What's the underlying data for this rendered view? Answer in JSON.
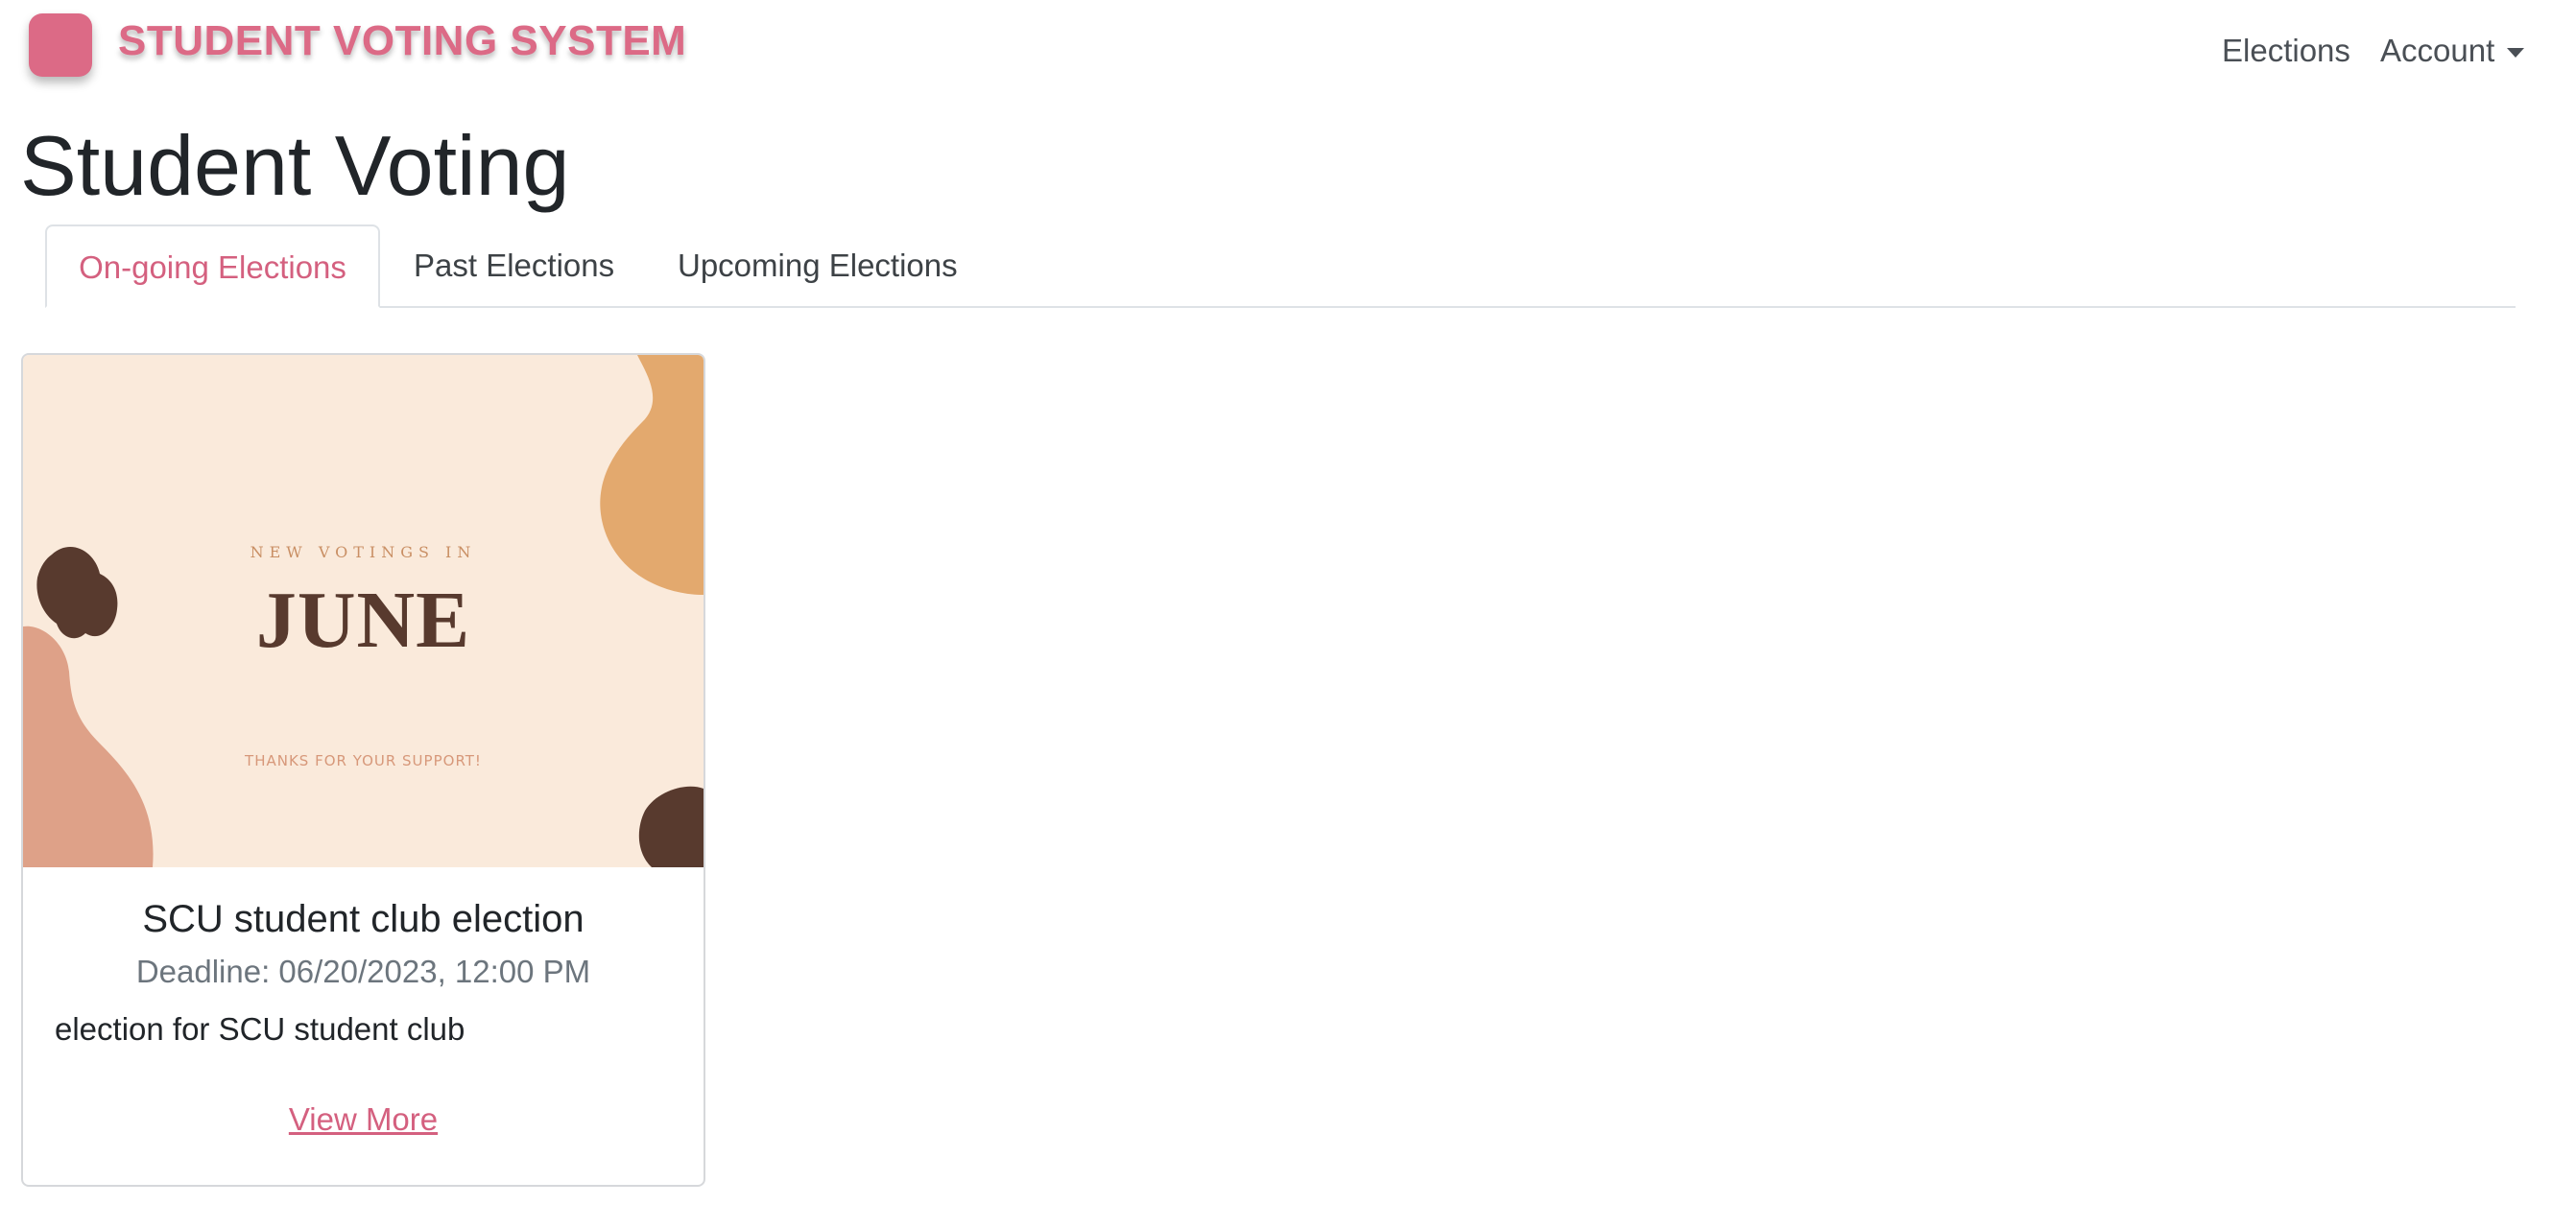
{
  "colors": {
    "brand": "#dc6a86",
    "tab_active": "#d4607f",
    "muted": "#6c757d",
    "image_bg": "#faeadb"
  },
  "navbar": {
    "brand_text": "STUDENT VOTING SYSTEM",
    "links": {
      "elections": "Elections",
      "account": "Account"
    }
  },
  "page": {
    "title": "Student Voting"
  },
  "tabs": [
    {
      "label": "On-going Elections",
      "active": true
    },
    {
      "label": "Past Elections",
      "active": false
    },
    {
      "label": "Upcoming Elections",
      "active": false
    }
  ],
  "cards": [
    {
      "image": {
        "kicker": "NEW VOTINGS IN",
        "headline": "JUNE",
        "footer": "THANKS FOR YOUR SUPPORT!"
      },
      "title": "SCU student club election",
      "deadline": "Deadline: 06/20/2023, 12:00 PM",
      "description": "election for SCU student club",
      "link_label": "View More"
    }
  ]
}
